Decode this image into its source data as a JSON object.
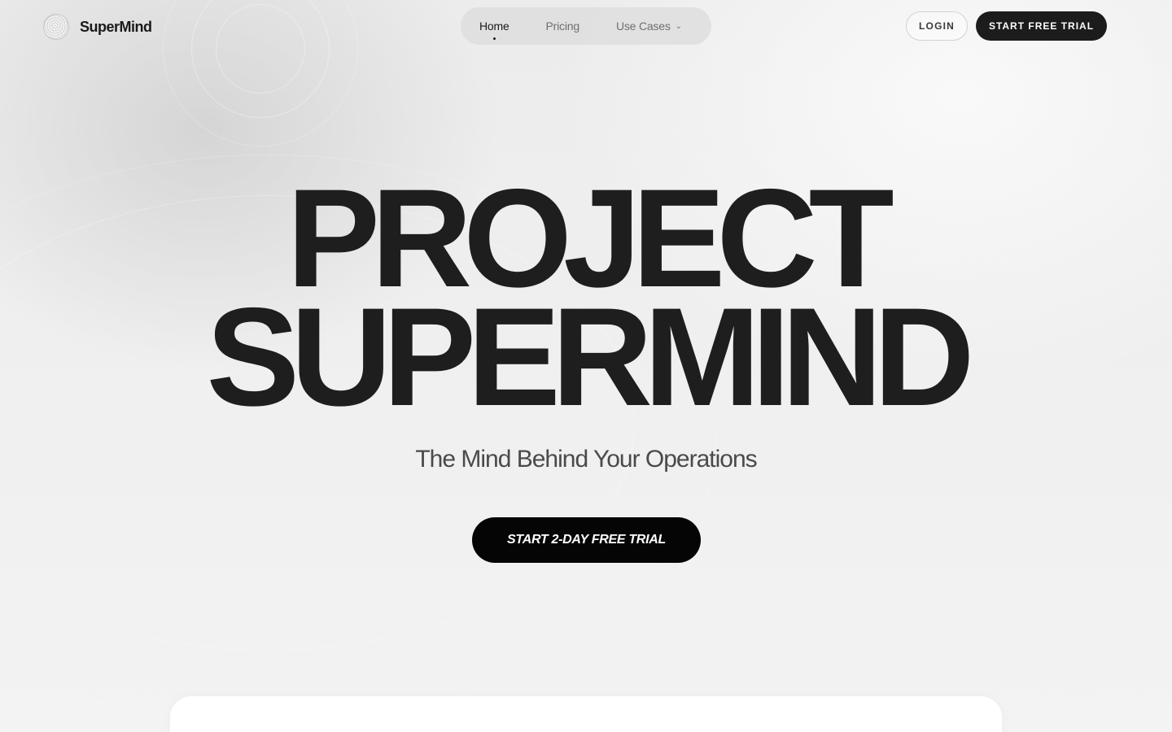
{
  "brand": {
    "name": "SuperMind",
    "logo_icon": "concentric-sphere-icon"
  },
  "nav": {
    "items": [
      {
        "label": "Home",
        "active": true
      },
      {
        "label": "Pricing",
        "active": false
      },
      {
        "label": "Use Cases",
        "active": false,
        "dropdown_icon": "chevron-down-icon"
      }
    ]
  },
  "header_actions": {
    "login_label": "LOGIN",
    "trial_label": "START FREE TRIAL"
  },
  "hero": {
    "title_line1": "PROJECT",
    "title_line2": "SUPERMIND",
    "subtitle": "The Mind Behind Your Operations",
    "cta_label": "START 2-DAY FREE TRIAL"
  },
  "colors": {
    "text_dark": "#1e1e1e",
    "button_dark": "#1c1c1c",
    "background": "#f3f3f3",
    "nav_pill": "#dedede"
  }
}
